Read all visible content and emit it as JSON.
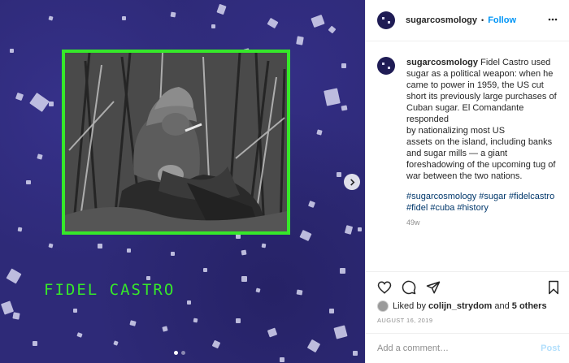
{
  "media": {
    "caption": "FIDEL CASTRO",
    "frame_color": "#36e82a",
    "background_color": "#2e2a78",
    "image_subject": "Black-and-white photo of a soldier in a helmet sitting among sugarcane stalks, smoking a cigar",
    "carousel_dots": 2,
    "active_dot": 1
  },
  "header": {
    "username": "sugarcosmology",
    "separator": "•",
    "follow_label": "Follow"
  },
  "caption": {
    "username": "sugarcosmology",
    "lines": [
      "Fidel Castro used",
      "sugar as a political weapon: when he",
      "came to power in 1959, the US cut",
      "short its previously large purchases of",
      "Cuban sugar. El Comandante",
      "responded",
      "by nationalizing most US",
      "assets on the island, including banks",
      "and sugar mills — a giant",
      "foreshadowing of the upcoming tug of",
      "war between the two nations."
    ],
    "hashtag_lines": [
      "#sugarcosmology #sugar #fidelcastro",
      "#fidel #cuba #history"
    ],
    "age": "49w"
  },
  "actions": {
    "liked_prefix": "Liked by",
    "liked_user": "colijn_strydom",
    "liked_and": "and",
    "liked_others": "5 others",
    "date": "AUGUST 16, 2019"
  },
  "comment": {
    "placeholder": "Add a comment…",
    "post_label": "Post"
  },
  "colors": {
    "link_blue": "#0095f6",
    "hashtag_blue": "#00376b",
    "post_disabled": "#b2dffc",
    "muted": "#8e8e8e"
  }
}
